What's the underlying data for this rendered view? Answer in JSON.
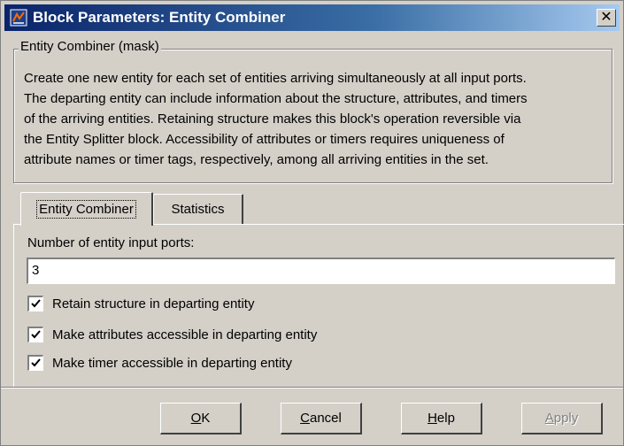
{
  "window": {
    "title": "Block Parameters: Entity Combiner",
    "close_glyph": "✕"
  },
  "group": {
    "legend": "Entity Combiner (mask)",
    "description_lines": [
      "Create one new entity for each set of entities arriving simultaneously at all input ports.",
      "The departing entity can include information about the structure, attributes, and timers",
      "of the arriving entities. Retaining structure makes this block's operation reversible via",
      "the Entity Splitter block. Accessibility of attributes or timers requires uniqueness of",
      "attribute names or timer tags, respectively, among all arriving entities in the set."
    ]
  },
  "tabs": [
    {
      "label": "Entity Combiner",
      "active": true
    },
    {
      "label": "Statistics",
      "active": false
    }
  ],
  "form": {
    "ports_label": "Number of entity input ports:",
    "ports_value": "3",
    "checkboxes": [
      {
        "label": "Retain structure in departing entity",
        "checked": true
      },
      {
        "label": "Make attributes accessible in departing entity",
        "checked": true
      },
      {
        "label": "Make timer accessible in departing entity",
        "checked": true
      }
    ]
  },
  "buttons": {
    "ok": {
      "mnemonic": "O",
      "rest": "K"
    },
    "cancel": {
      "mnemonic": "C",
      "rest": "ancel"
    },
    "help": {
      "mnemonic": "H",
      "rest": "elp"
    },
    "apply": {
      "mnemonic": "A",
      "rest": "pply",
      "enabled": false
    }
  },
  "colors": {
    "titlebar_start": "#0a246a",
    "titlebar_end": "#a6caf0",
    "face": "#d4d0c8"
  },
  "icons": {
    "title": "simulink-block-icon",
    "close": "close-icon",
    "check": "checkmark-icon"
  }
}
